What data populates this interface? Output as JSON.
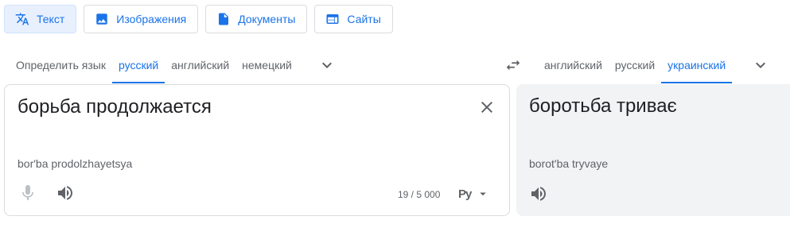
{
  "modes": [
    {
      "label": "Текст",
      "icon": "translate-icon",
      "active": true
    },
    {
      "label": "Изображения",
      "icon": "image-icon",
      "active": false
    },
    {
      "label": "Документы",
      "icon": "document-icon",
      "active": false
    },
    {
      "label": "Сайты",
      "icon": "website-icon",
      "active": false
    }
  ],
  "source_langs": [
    "Определить язык",
    "русский",
    "английский",
    "немецкий"
  ],
  "target_langs": [
    "английский",
    "русский",
    "украинский"
  ],
  "source": {
    "text": "борьба продолжается",
    "transliteration": "bor'ba prodolzhayetsya",
    "char_count": "19 / 5 000",
    "keyboard_label": "Ру"
  },
  "target": {
    "text": "боротьба триває",
    "transliteration": "borot'ba tryvaye"
  },
  "colors": {
    "accent": "#1a73e8",
    "panel_bg": "#f1f3f4"
  }
}
